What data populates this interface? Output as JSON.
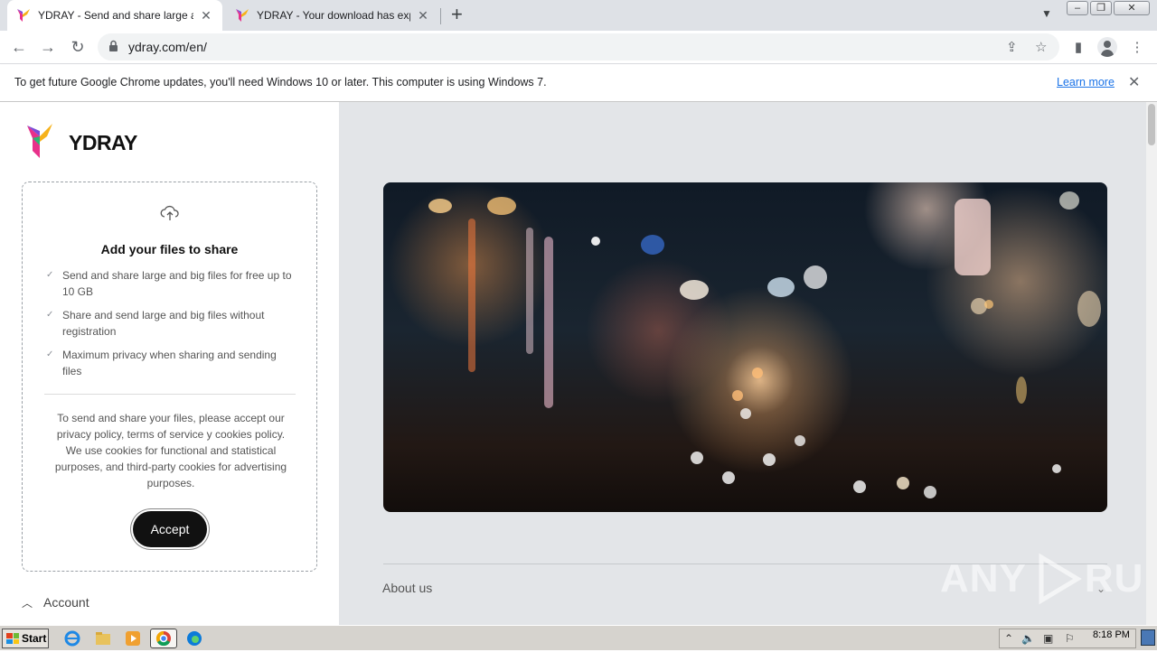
{
  "browser": {
    "tabs": [
      {
        "title": "YDRAY - Send and share large and b",
        "active": true
      },
      {
        "title": "YDRAY - Your download has expired",
        "active": false
      }
    ],
    "url": "ydray.com/en/"
  },
  "infobar": {
    "message": "To get future Google Chrome updates, you'll need Windows 10 or later. This computer is using Windows 7.",
    "learn_more": "Learn more"
  },
  "sidebar": {
    "brand": "YDRAY",
    "card_title": "Add your files to share",
    "features": [
      "Send and share large and big files for free up to 10 GB",
      "Share and send large and big files without registration",
      "Maximum privacy when sharing and sending files"
    ],
    "consent": "To send and share your files, please accept our privacy policy, terms of service y cookies policy. We use cookies for functional and statistical purposes, and third-party cookies for advertising purposes.",
    "accept_label": "Accept",
    "account_label": "Account"
  },
  "main": {
    "about_label": "About us"
  },
  "watermark": {
    "left": "ANY",
    "right": "RUN"
  },
  "taskbar": {
    "start_label": "Start",
    "clock": "8:18 PM"
  },
  "colors": {
    "accent_link": "#1a73e8",
    "brand_dark": "#111111",
    "page_bg": "#e3e5e8"
  }
}
